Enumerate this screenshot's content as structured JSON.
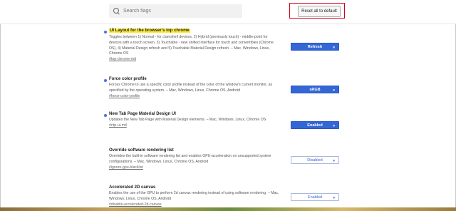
{
  "search": {
    "placeholder": "Search flags"
  },
  "reset": {
    "label": "Reset all to default"
  },
  "flags": [
    {
      "title": "UI Layout for the browser's top chrome",
      "highlighted": true,
      "description": "Toggles between 1) Normal - for clamshell devices, 2) Hybrid (previously touch) - middle-point for devices with a touch screen, 3) Touchable - new unified interface for touch and convertibles (Chrome OS), 4) Material Design refresh and 5) Touchable Material Design refresh. – Mac, Windows, Linux, Chrome OS",
      "link": "#top-chrome-md",
      "value": "Refresh",
      "style": "filled"
    },
    {
      "title": "Force color profile",
      "highlighted": false,
      "description": "Forces Chrome to use a specific color profile instead of the color of the window's current monitor, as specified by the operating system. – Mac, Windows, Linux, Chrome OS, Android",
      "link": "#force-color-profile",
      "value": "sRGB",
      "style": "filled"
    },
    {
      "title": "New Tab Page Material Design UI",
      "highlighted": false,
      "description": "Updates the New Tab Page with Material Design elements. – Mac, Windows, Linux, Chrome OS",
      "link": "#ntp-ui-md",
      "value": "Enabled",
      "style": "filled"
    },
    {
      "title": "Override software rendering list",
      "highlighted": false,
      "description": "Overrides the built-in software rendering list and enables GPU-acceleration on unsupported system configurations. – Mac, Windows, Linux, Chrome OS, Android",
      "link": "#ignore-gpu-blacklist",
      "value": "Disabled",
      "style": "outline"
    },
    {
      "title": "Accelerated 2D canvas",
      "highlighted": false,
      "description": "Enables the use of the GPU to perform 2d canvas rendering instead of using software rendering. – Mac, Windows, Linux, Chrome OS, Android",
      "link": "#disable-accelerated-2d-canvas",
      "value": "Enabled",
      "style": "outline"
    }
  ],
  "colors": {
    "accent": "#3367d6",
    "dot": "#3b78e7",
    "highlight": "#ffeb3b",
    "reset_border": "#d0021b"
  },
  "icons": {
    "search": "search-icon",
    "dropdown": "chevron-down-icon"
  }
}
